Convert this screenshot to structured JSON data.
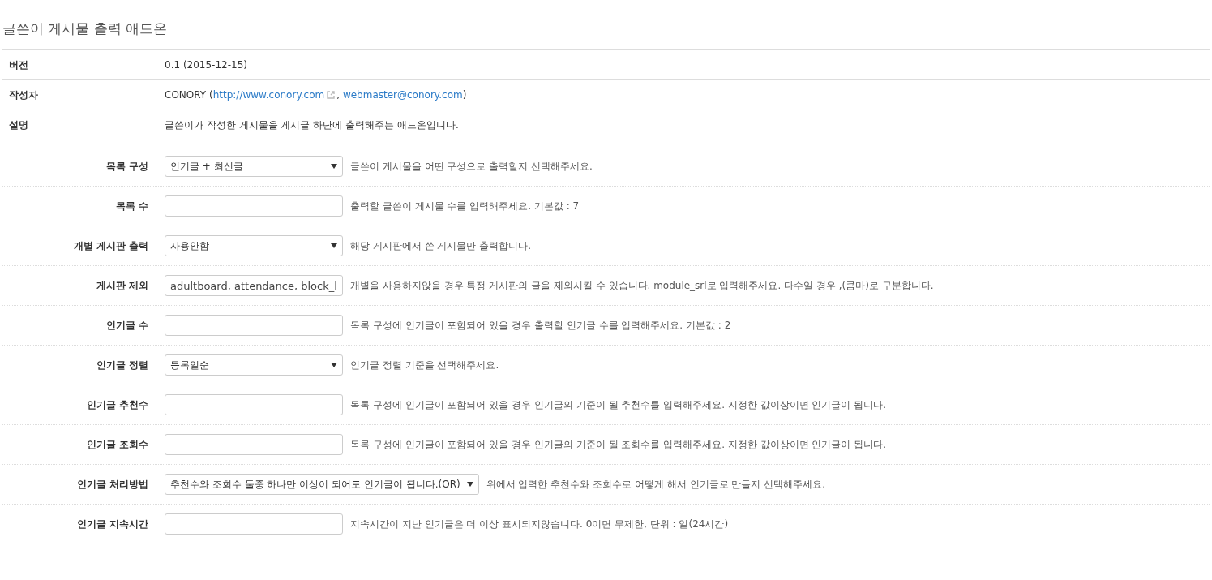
{
  "title": "글쓴이 게시물 출력 애드온",
  "info": [
    {
      "label": "버전",
      "parts": [
        {
          "kind": "text",
          "text": "0.1 (2015-12-15)"
        }
      ]
    },
    {
      "label": "작성자",
      "parts": [
        {
          "kind": "text",
          "text": "CONORY ("
        },
        {
          "kind": "link",
          "text": "http://www.conory.com",
          "external": true
        },
        {
          "kind": "text",
          "text": ", "
        },
        {
          "kind": "link",
          "text": "webmaster@conory.com"
        },
        {
          "kind": "text",
          "text": ")"
        }
      ]
    },
    {
      "label": "설명",
      "parts": [
        {
          "kind": "text",
          "text": "글쓴이가 작성한 게시물을 게시글 하단에 출력해주는 애드온입니다."
        }
      ]
    }
  ],
  "fields": [
    {
      "label": "목록 구성",
      "kind": "select",
      "value": "인기글 + 최신글",
      "help": "글쓴이 게시물을 어떤 구성으로 출력할지 선택해주세요."
    },
    {
      "label": "목록 수",
      "kind": "input",
      "help": "출력할 글쓴이 게시물 수를 입력해주세요. 기본값 : 7"
    },
    {
      "label": "개별 게시판 출력",
      "kind": "select",
      "value": "사용안함",
      "help": "해당 게시판에서 쓴 게시물만 출력합니다."
    },
    {
      "label": "게시판 제외",
      "kind": "input",
      "value": "adultboard, attendance, block_l",
      "help": "개별을 사용하지않을 경우 특정 게시판의 글을 제외시킬 수 있습니다. module_srl로 입력해주세요. 다수일 경우 ,(콤마)로 구분합니다."
    },
    {
      "label": "인기글 수",
      "kind": "input",
      "help": "목록 구성에 인기글이 포함되어 있을 경우 출력할 인기글 수를 입력해주세요. 기본값 : 2"
    },
    {
      "label": "인기글 정렬",
      "kind": "select",
      "value": "등록일순",
      "help": "인기글 정렬 기준을 선택해주세요."
    },
    {
      "label": "인기글 추천수",
      "kind": "input",
      "help": "목록 구성에 인기글이 포함되어 있을 경우 인기글의 기준이 될 추천수를 입력해주세요. 지정한 값이상이면 인기글이 됩니다."
    },
    {
      "label": "인기글 조회수",
      "kind": "input",
      "help": "목록 구성에 인기글이 포함되어 있을 경우 인기글의 기준이 될 조회수를 입력해주세요. 지정한 값이상이면 인기글이 됩니다."
    },
    {
      "label": "인기글 처리방법",
      "kind": "select",
      "value": "추천수와 조회수 둘중 하나만 이상이 되어도 인기글이 됩니다.(OR)",
      "help": "위에서 입력한 추천수와 조회수로 어떻게 해서 인기글로 만들지 선택해주세요."
    },
    {
      "label": "인기글 지속시간",
      "kind": "input",
      "help": "지속시간이 지난 인기글은 더 이상 표시되지않습니다. 0이면 무제한, 단위 : 일(24시간)"
    }
  ]
}
